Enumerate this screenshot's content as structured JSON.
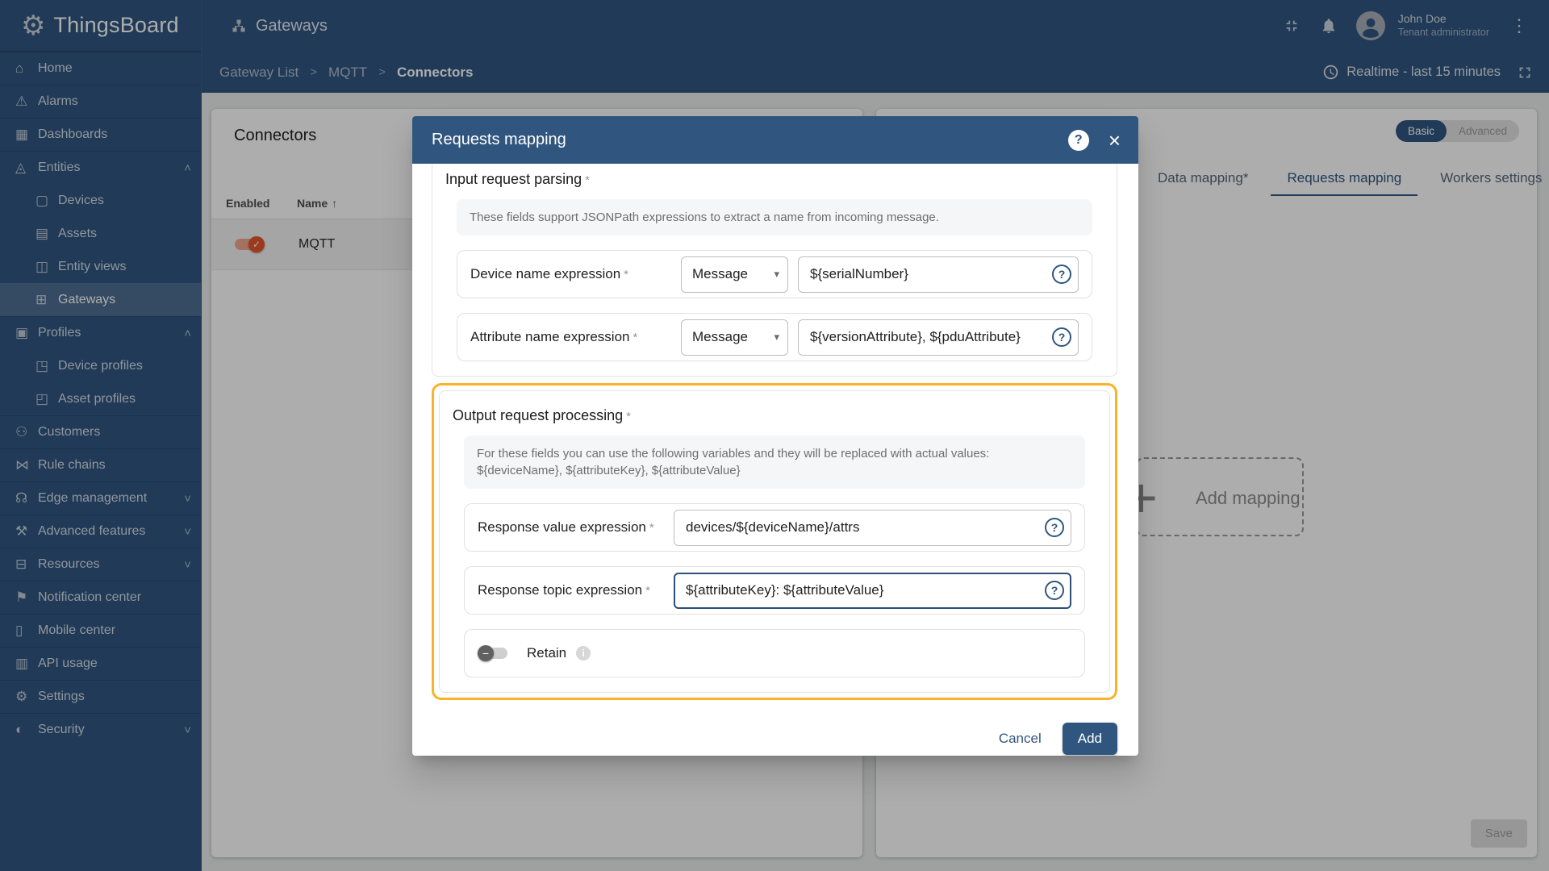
{
  "ui": {
    "required_marker": "*",
    "sort_arrow": "↑",
    "select_caret": "▾",
    "kebab_glyph": "⋮",
    "close_glyph": "×",
    "help_glyph": "?",
    "info_glyph": "i",
    "minus_glyph": "−",
    "check_glyph": "✓",
    "plus_glyph": "+"
  },
  "brand": {
    "name": "ThingsBoard",
    "logo_glyph": "⚙"
  },
  "topbar": {
    "title": "Gateways",
    "user": {
      "name": "John Doe",
      "role": "Tenant administrator"
    }
  },
  "breadcrumb": {
    "crumbs": [
      {
        "label": "Gateway List",
        "sep": ">"
      },
      {
        "label": "MQTT",
        "sep": ">"
      },
      {
        "label": "Connectors",
        "sep": "",
        "active": true
      }
    ],
    "timewindow": "Realtime - last 15 minutes"
  },
  "sidebar": {
    "items": [
      {
        "icon": "⌂",
        "label": "Home",
        "chevron": ""
      },
      {
        "icon": "⚠",
        "label": "Alarms",
        "chevron": ""
      },
      {
        "icon": "▦",
        "label": "Dashboards",
        "chevron": ""
      },
      {
        "icon": "◬",
        "label": "Entities",
        "chevron": "˄"
      },
      {
        "icon": "▢",
        "label": "Devices",
        "chevron": "",
        "sub": true
      },
      {
        "icon": "▤",
        "label": "Assets",
        "chevron": "",
        "sub": true
      },
      {
        "icon": "◫",
        "label": "Entity views",
        "chevron": "",
        "sub": true
      },
      {
        "icon": "⊞",
        "label": "Gateways",
        "chevron": "",
        "sub": true,
        "active": true
      },
      {
        "icon": "▣",
        "label": "Profiles",
        "chevron": "˄"
      },
      {
        "icon": "◳",
        "label": "Device profiles",
        "chevron": "",
        "sub": true
      },
      {
        "icon": "◰",
        "label": "Asset profiles",
        "chevron": "",
        "sub": true
      },
      {
        "icon": "⚇",
        "label": "Customers",
        "chevron": ""
      },
      {
        "icon": "⋈",
        "label": "Rule chains",
        "chevron": ""
      },
      {
        "icon": "☊",
        "label": "Edge management",
        "chevron": "˅"
      },
      {
        "icon": "⚒",
        "label": "Advanced features",
        "chevron": "˅"
      },
      {
        "icon": "⊟",
        "label": "Resources",
        "chevron": "˅"
      },
      {
        "icon": "⚑",
        "label": "Notification center",
        "chevron": ""
      },
      {
        "icon": "▯",
        "label": "Mobile center",
        "chevron": ""
      },
      {
        "icon": "▥",
        "label": "API usage",
        "chevron": ""
      },
      {
        "icon": "⚙",
        "label": "Settings",
        "chevron": ""
      },
      {
        "icon": "◐",
        "label": "Security",
        "chevron": "˅"
      }
    ]
  },
  "connectors": {
    "title": "Connectors",
    "col_enabled": "Enabled",
    "col_name": "Name",
    "rows": [
      {
        "name": "MQTT",
        "enabled": true
      }
    ]
  },
  "config": {
    "modes": [
      {
        "label": "Basic",
        "active": true
      },
      {
        "label": "Advanced"
      }
    ],
    "tabs": [
      {
        "label": "Data mapping*"
      },
      {
        "label": "Requests mapping",
        "active": true
      },
      {
        "label": "Workers settings"
      }
    ],
    "add_mapping_label": "Add mapping",
    "save_label": "Save"
  },
  "dialog": {
    "title": "Requests mapping",
    "input_section": {
      "heading": "Input request parsing",
      "hint": "These fields support JSONPath expressions to extract a name from incoming message.",
      "device_field": {
        "label": "Device name expression",
        "source": "Message",
        "value": "${serialNumber}"
      },
      "attribute_field": {
        "label": "Attribute name expression",
        "source": "Message",
        "value": "${versionAttribute}, ${pduAttribute}"
      }
    },
    "output_section": {
      "heading": "Output request processing",
      "hint": "For these fields you can use the following variables and they will be replaced with actual values: ${deviceName}, ${attributeKey}, ${attributeValue}",
      "value_field": {
        "label": "Response value expression",
        "value": "devices/${deviceName}/attrs"
      },
      "topic_field": {
        "label": "Response topic expression",
        "value": "${attributeKey}: ${attributeValue}"
      },
      "retain": {
        "label": "Retain",
        "state": "off"
      }
    },
    "cancel_label": "Cancel",
    "add_label": "Add"
  },
  "colors": {
    "primary": "#305680",
    "highlight": "#fab327",
    "toggle_on": "#e8552b",
    "overlay": "rgba(0,0,0,0.32)"
  }
}
